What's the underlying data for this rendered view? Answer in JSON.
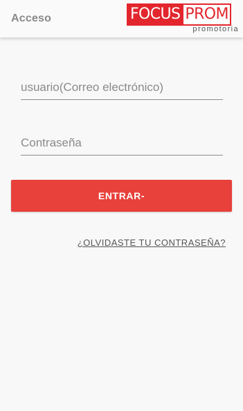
{
  "appbar": {
    "title": "Acceso",
    "logo": {
      "brand_red": "FOCUS",
      "brand_white": "PROM",
      "subtitle": "promotoria",
      "color": "#e3262d"
    }
  },
  "form": {
    "user_placeholder": "usuario(Correo electrónico)",
    "user_value": "",
    "password_placeholder": "Contraseña",
    "password_value": "",
    "login_label": "ENTRAR-",
    "forgot_label": "¿OLVIDASTE TU CONTRASEÑA?"
  },
  "colors": {
    "accent": "#e8403b",
    "background": "#f8f8f8"
  }
}
